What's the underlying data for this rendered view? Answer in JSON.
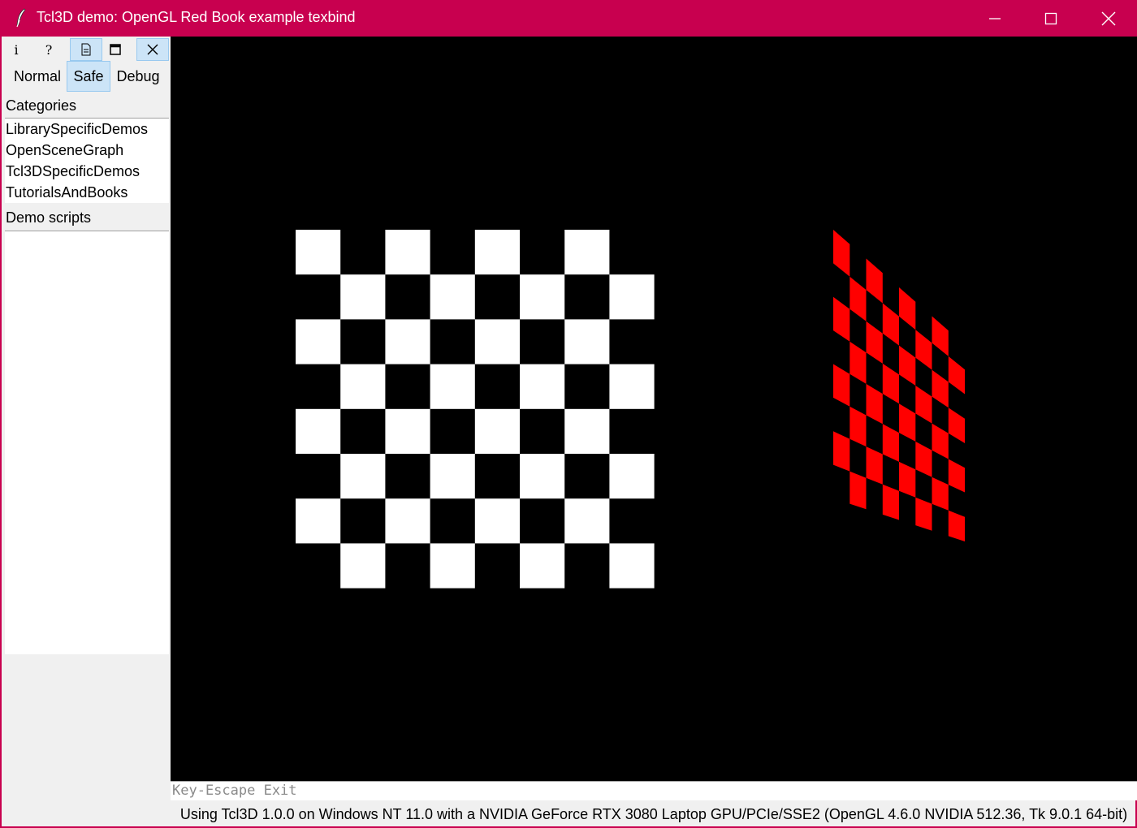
{
  "window": {
    "title": "Tcl3D demo: OpenGL Red Book example texbind",
    "accent_color": "#c8004f"
  },
  "toolbar": {
    "buttons": [
      {
        "icon": "info-icon",
        "glyph": "i"
      },
      {
        "icon": "help-icon",
        "glyph": "?"
      },
      {
        "icon": "document-icon"
      },
      {
        "icon": "fullscreen-icon"
      },
      {
        "icon": "close-icon"
      }
    ],
    "modes": [
      "Normal",
      "Safe",
      "Debug"
    ],
    "active_mode": "Safe"
  },
  "categories": {
    "label": "Categories",
    "items": [
      "LibrarySpecificDemos",
      "OpenSceneGraph",
      "Tcl3DSpecificDemos",
      "TutorialsAndBooks"
    ]
  },
  "demo_scripts": {
    "label": "Demo scripts",
    "items": []
  },
  "scene": {
    "background": "#000000",
    "left_texture_color": "#ffffff",
    "right_texture_color": "#ff0000",
    "checker_size": 8
  },
  "info": {
    "key_help": "Key-Escape Exit"
  },
  "status": {
    "text": "Using Tcl3D 1.0.0 on Windows NT 11.0 with a NVIDIA GeForce RTX 3080 Laptop GPU/PCIe/SSE2 (OpenGL 4.6.0 NVIDIA 512.36, Tk 9.0.1 64-bit)"
  }
}
